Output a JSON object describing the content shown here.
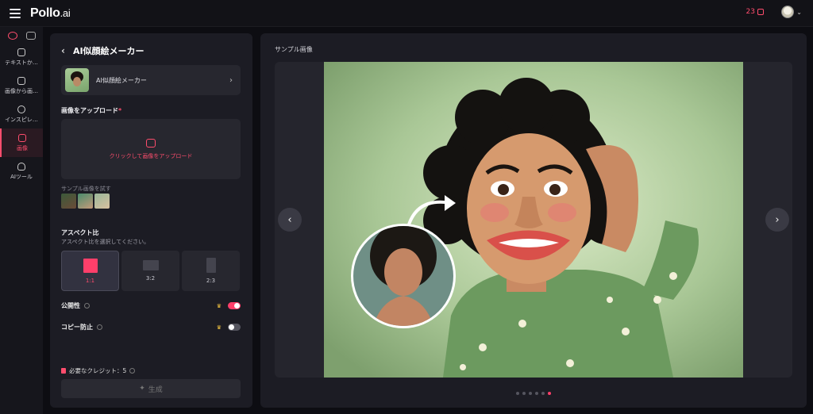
{
  "app": {
    "logo_main": "Pollo",
    "logo_suffix": ".ai",
    "credits": "23"
  },
  "rail": {
    "items": [
      {
        "label": "テキストか…",
        "icon": "text-to-video-icon"
      },
      {
        "label": "画像から画…",
        "icon": "image-to-image-icon"
      },
      {
        "label": "インスピレ…",
        "icon": "compass-icon"
      },
      {
        "label": "画像",
        "icon": "image-icon"
      },
      {
        "label": "AIツール",
        "icon": "toolbox-icon"
      }
    ]
  },
  "left": {
    "title": "AI似顔絵メーカー",
    "tool_name": "AI似顔絵メーカー",
    "upload_label": "画像をアップロード",
    "required_mark": "*",
    "upload_cta": "クリックして画像をアップロード",
    "sample_label": "サンプル画像を試す",
    "aspect_title": "アスペクト比",
    "aspect_sub": "アスペクト比を選択してください。",
    "ratios": [
      "1:1",
      "3:2",
      "2:3"
    ],
    "public_label": "公開性",
    "copy_label": "コピー防止",
    "credit_text": "必要なクレジット：5",
    "generate_label": "生成"
  },
  "right": {
    "title": "サンプル画像",
    "dots": 6,
    "active_dot": 5
  },
  "colors": {
    "accent": "#ff3f6a",
    "panel": "#1c1c24",
    "background": "#0d0d12"
  }
}
